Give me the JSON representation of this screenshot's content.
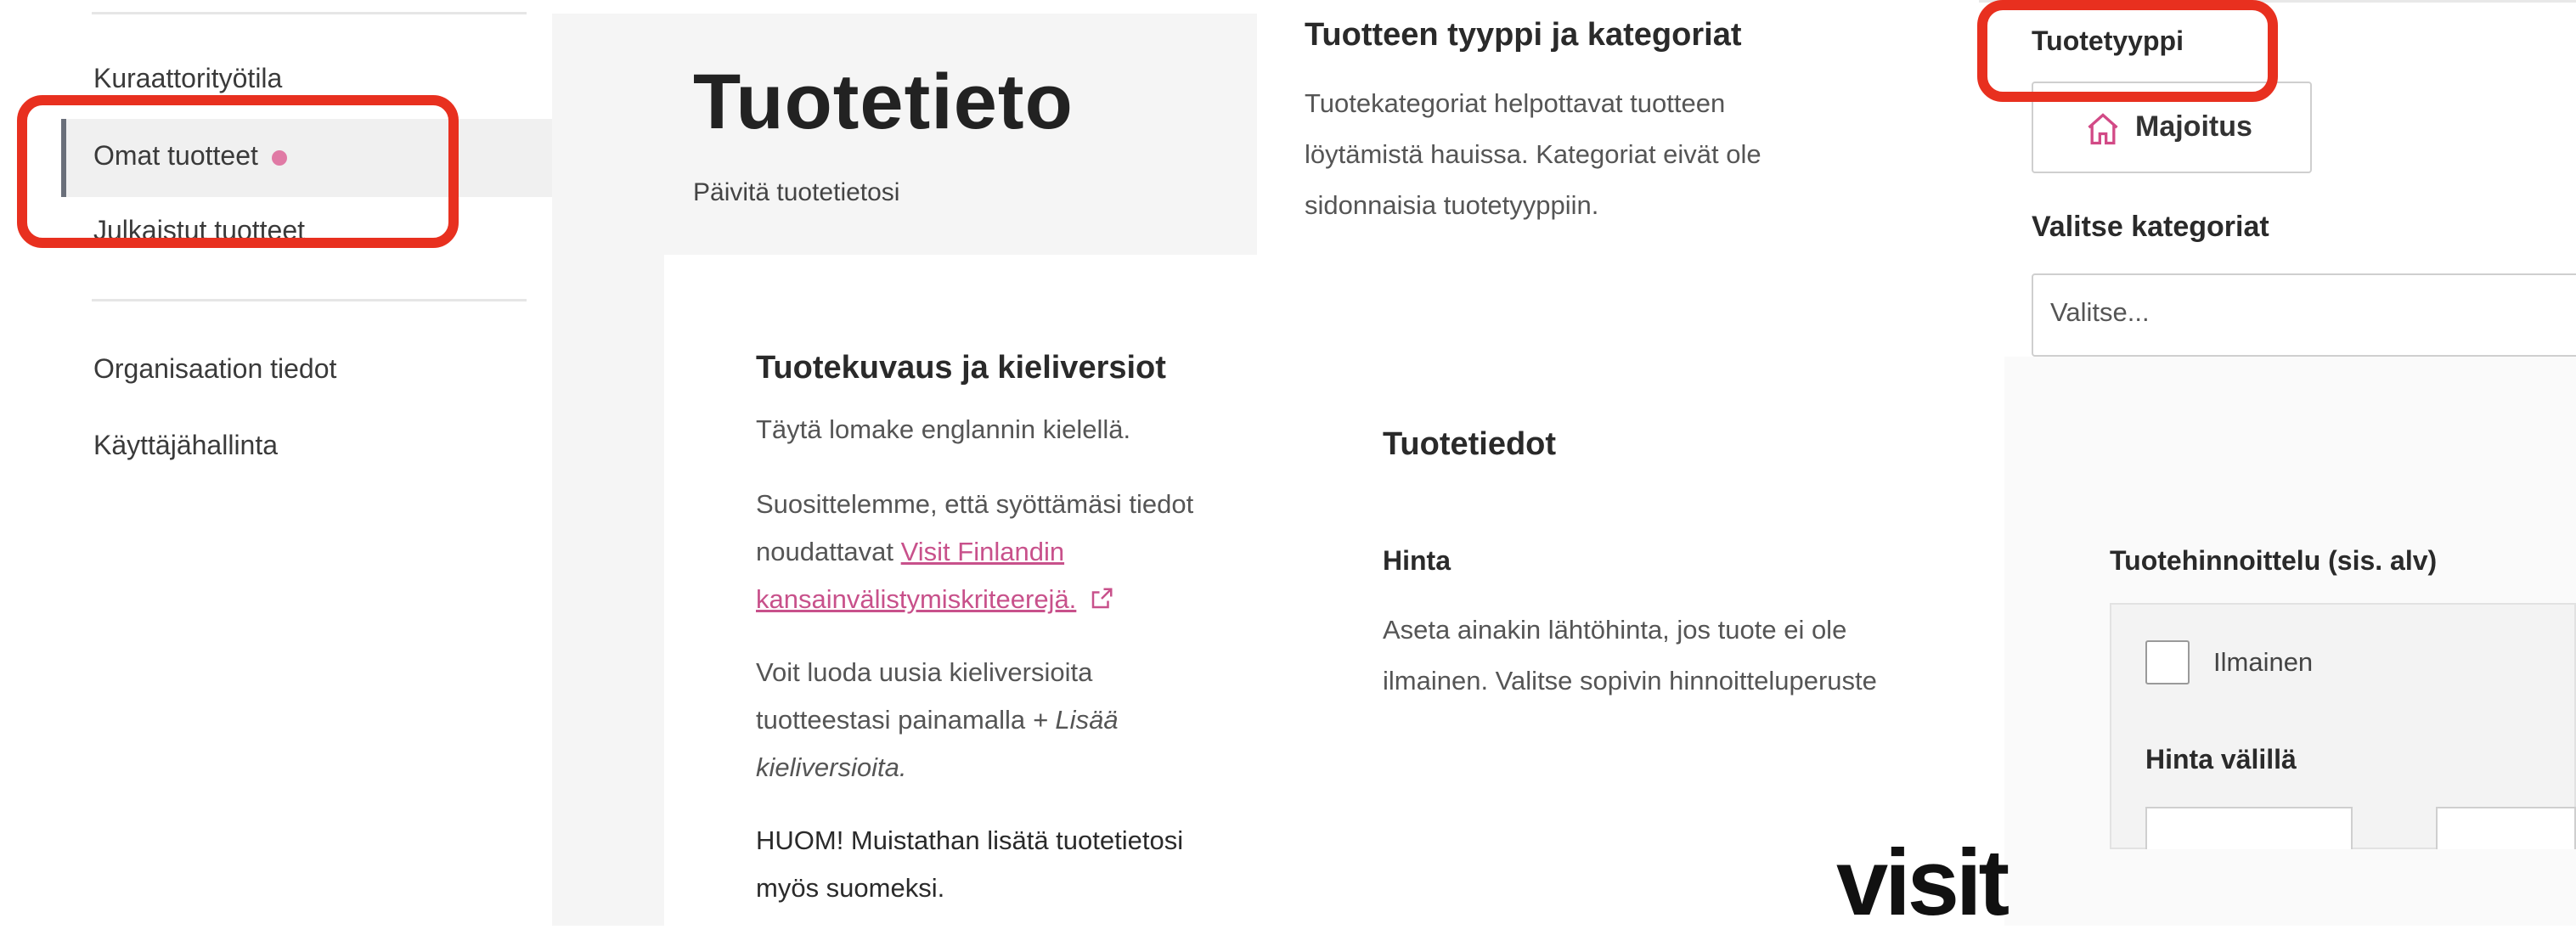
{
  "sidebar": {
    "items": [
      {
        "label": "Kuraattorityötila"
      },
      {
        "label": "Omat tuotteet"
      },
      {
        "label": "Julkaistut tuotteet"
      },
      {
        "label": "Organisaation tiedot"
      },
      {
        "label": "Käyttäjähallinta"
      }
    ]
  },
  "main": {
    "title": "Tuotetieto",
    "subtitle": "Päivitä tuotetietosi",
    "description_card": {
      "heading": "Tuotekuvaus ja kieliversiot",
      "p1": "Täytä lomake englannin kielellä.",
      "p2_prefix": "Suosittelemme, että syöttämäsi tiedot noudattavat",
      "p2_link": "Visit Finlandin kansainvälistymiskriteerejä.",
      "p3_prefix": "Voit luoda uusia kieliversioita tuotteestasi painamalla",
      "p3_em": "+ Lisää kieliversioita.",
      "p4": "HUOM! Muistathan lisätä tuotetietosi myös suomeksi."
    }
  },
  "type_section": {
    "heading": "Tuotteen tyyppi ja kategoriat",
    "text": "Tuotekategoriat helpottavat tuotteen löytämistä hauissa. Kategoriat eivät ole sidonnaisia tuotetyyppiin.",
    "type_label": "Tuotetyyppi",
    "type_button": "Majoitus",
    "categories_label": "Valitse kategoriat",
    "categories_placeholder": "Valitse..."
  },
  "product_info": {
    "heading": "Tuotetiedot",
    "price_label": "Hinta",
    "price_text": "Aseta ainakin lähtöhinta, jos tuote ei ole ilmainen. Valitse sopivin hinnoitteluperuste"
  },
  "pricing": {
    "heading": "Tuotehinnoittelu (sis. alv)",
    "free_label": "Ilmainen",
    "range_label": "Hinta välillä"
  },
  "logo": {
    "text": "visit"
  },
  "colors": {
    "highlight": "#e8301f",
    "accent": "#e07aa5",
    "link": "#c8518b"
  }
}
